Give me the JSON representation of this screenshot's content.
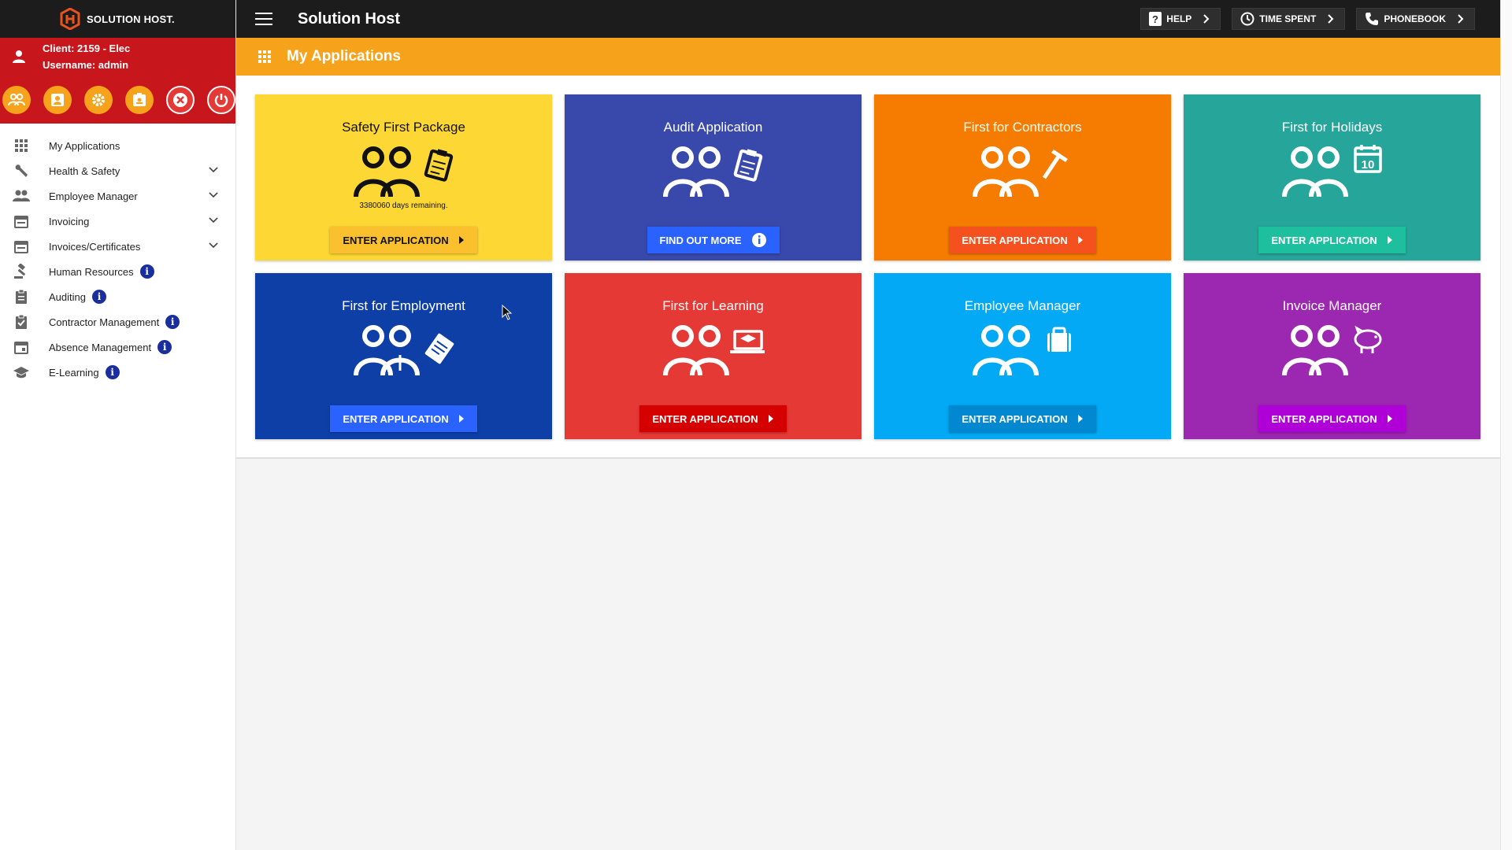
{
  "brand": {
    "logo_text": "SOLUTION HOST.",
    "app_title": "Solution Host"
  },
  "user": {
    "client": "Client: 2159 - Elec",
    "username": "Username: admin"
  },
  "top_buttons": [
    {
      "label": "HELP",
      "icon": "help-icon"
    },
    {
      "label": "TIME SPENT",
      "icon": "clock-icon"
    },
    {
      "label": "PHONEBOOK",
      "icon": "phone-icon"
    }
  ],
  "toolbar_icons": [
    "users-icon",
    "contact-card-icon",
    "settings-icon",
    "badge-icon",
    "close-icon",
    "power-icon"
  ],
  "nav": {
    "items": [
      {
        "label": "My Applications",
        "icon": "grid-icon",
        "chevron": false,
        "info": false
      },
      {
        "label": "Health & Safety",
        "icon": "wrench-icon",
        "chevron": true,
        "info": false
      },
      {
        "label": "Employee Manager",
        "icon": "people-icon",
        "chevron": true,
        "info": false
      },
      {
        "label": "Invoicing",
        "icon": "calendar-icon",
        "chevron": true,
        "info": false
      },
      {
        "label": "Invoices/Certificates",
        "icon": "calendar-icon",
        "chevron": true,
        "info": false
      },
      {
        "label": "Human Resources",
        "icon": "gavel-icon",
        "chevron": false,
        "info": true
      },
      {
        "label": "Auditing",
        "icon": "clipboard-icon",
        "chevron": false,
        "info": true
      },
      {
        "label": "Contractor Management",
        "icon": "checklist-icon",
        "chevron": false,
        "info": true
      },
      {
        "label": "Absence Management",
        "icon": "calendar-icon",
        "chevron": false,
        "info": true
      },
      {
        "label": "E-Learning",
        "icon": "graduation-cap-icon",
        "chevron": false,
        "info": true
      }
    ]
  },
  "header": {
    "title": "My Applications"
  },
  "tiles": [
    {
      "title": "Safety First Package",
      "note": "3380060 days remaining.",
      "button": "ENTER APPLICATION",
      "bg": "#fdd835",
      "fg": "#111111",
      "btn_bg": "#fbc02d",
      "btn_fg": "#111111",
      "icon": "clipboard-icon"
    },
    {
      "title": "Audit Application",
      "note": "",
      "button": "FIND OUT MORE",
      "bg": "#3949ab",
      "fg": "#ffffff",
      "btn_bg": "#2962ff",
      "btn_fg": "#ffffff",
      "icon": "clipboard-icon",
      "button_icon": "info-icon"
    },
    {
      "title": "First for Contractors",
      "note": "",
      "button": "ENTER APPLICATION",
      "bg": "#f57c00",
      "fg": "#ffffff",
      "btn_bg": "#f4511e",
      "btn_fg": "#ffffff",
      "icon": "hammer-icon"
    },
    {
      "title": "First for Holidays",
      "note": "",
      "button": "ENTER APPLICATION",
      "bg": "#26a69a",
      "fg": "#ffffff",
      "btn_bg": "#1dbf9f",
      "btn_fg": "#ffffff",
      "icon": "calendar-10-icon"
    },
    {
      "title": "First for Employment",
      "note": "",
      "button": "ENTER APPLICATION",
      "bg": "#0d3fa6",
      "fg": "#ffffff",
      "btn_bg": "#2962ff",
      "btn_fg": "#ffffff",
      "icon": "id-badge-icon"
    },
    {
      "title": "First for Learning",
      "note": "",
      "button": "ENTER APPLICATION",
      "bg": "#e53935",
      "fg": "#ffffff",
      "btn_bg": "#d50000",
      "btn_fg": "#ffffff",
      "icon": "laptop-cap-icon"
    },
    {
      "title": "Employee Manager",
      "note": "",
      "button": "ENTER APPLICATION",
      "bg": "#03a9f4",
      "fg": "#ffffff",
      "btn_bg": "#0288d1",
      "btn_fg": "#ffffff",
      "icon": "briefcase-icon"
    },
    {
      "title": "Invoice Manager",
      "note": "",
      "button": "ENTER APPLICATION",
      "bg": "#9c27b0",
      "fg": "#ffffff",
      "btn_bg": "#b000d8",
      "btn_fg": "#ffffff",
      "icon": "piggy-bank-icon"
    }
  ]
}
